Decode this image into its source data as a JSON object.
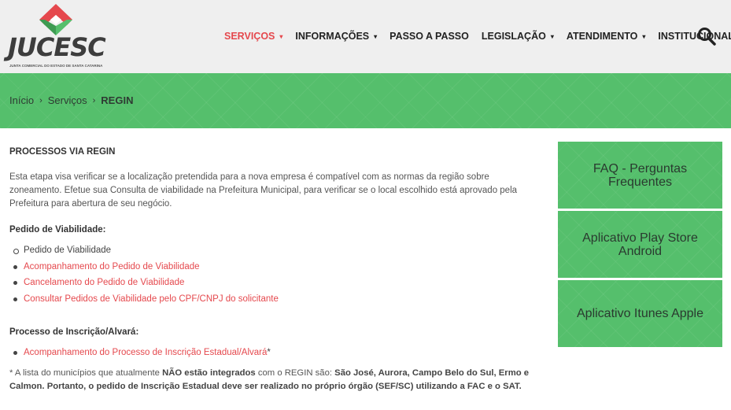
{
  "logo": {
    "text": "JUCESC",
    "subtitle": "JUNTA COMERCIAL DO ESTADO DE SANTA CATARINA",
    "colors": {
      "red": "#e5484d",
      "green": "#55bf6c"
    }
  },
  "nav": {
    "items": [
      {
        "label": "SERVIÇOS",
        "dropdown": "▾"
      },
      {
        "label": "INFORMAÇÕES",
        "dropdown": "▾"
      },
      {
        "label": "PASSO A PASSO"
      },
      {
        "label": "LEGISLAÇÃO",
        "dropdown": "▾"
      },
      {
        "label": "ATENDIMENTO",
        "dropdown": "▾"
      },
      {
        "label": "INSTITUCIONAL",
        "dropdown": "▾"
      }
    ],
    "active_color": "#e5484d",
    "search_icon": "search-icon"
  },
  "breadcrumb": {
    "items": [
      "Início",
      "Serviços",
      "REGIN"
    ],
    "separator": "›"
  },
  "main": {
    "title": "PROCESSOS VIA REGIN",
    "intro": "Esta etapa visa verificar se a localização pretendida para a nova empresa é compatível com as normas da região sobre zoneamento. Efetue sua Consulta de viabilidade na Prefeitura Municipal, para verificar se o local escolhido está aprovado pela Prefeitura para abertura de seu negócio.",
    "viabilidade": {
      "heading": "Pedido de Viabilidade:",
      "items": [
        "Pedido de Viabilidade",
        "Acompanhamento do Pedido de Viabilidade",
        "Cancelamento do Pedido de Viabilidade",
        "Consultar Pedidos de Viabilidade pelo CPF/CNPJ do solicitante"
      ]
    },
    "inscricao": {
      "heading": "Processo de Inscrição/Alvará:",
      "items": [
        "Acompanhamento do Processo de Inscrição Estadual/Alvará"
      ],
      "asterisk": "*"
    },
    "note": {
      "part1": "* A lista do municípios que atualmente ",
      "bold1": "NÃO estão integrados",
      "part2": " com o REGIN são: ",
      "bold2": "São José, Aurora, Campo Belo do Sul, Ermo e Calmon. Portanto, o pedido de Inscrição Estadual deve ser realizado no próprio órgão (SEF/SC) utilizando a FAC e o SAT."
    }
  },
  "sidebar": {
    "boxes": [
      "FAQ - Perguntas Frequentes",
      "Aplicativo Play Store Android",
      "Aplicativo Itunes Apple"
    ]
  }
}
